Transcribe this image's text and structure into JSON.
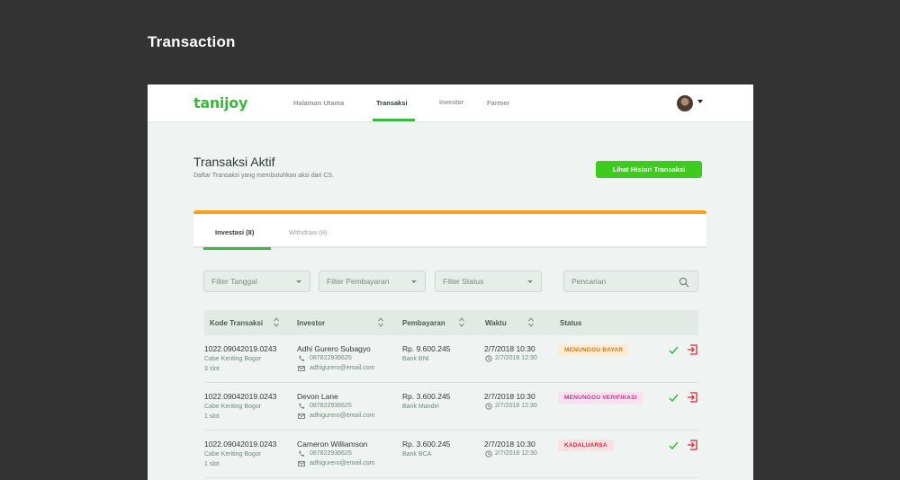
{
  "page_heading": "Transaction",
  "nav": {
    "logo": "tanijoy",
    "items": [
      "Halaman Utama",
      "Transaksi",
      "Investor",
      "Farmer"
    ]
  },
  "main": {
    "title": "Transaksi Aktif",
    "subtitle": "Daftar Transaksi yang membutuhkan aksi dari CS.",
    "history_button": "Lihat Histori Transaksi"
  },
  "tabs": [
    "Investasi (8)",
    "Withdraw (8)"
  ],
  "filters": {
    "tanggal": "Filter Tanggal",
    "pembayaran": "Filter Pembayaran",
    "status": "Filter Status",
    "search_placeholder": "Pencarian"
  },
  "table": {
    "headers": [
      "Kode Transaksi",
      "Investor",
      "Pembayaran",
      "Waktu",
      "Status"
    ],
    "rows": [
      {
        "code": "1022.09042019.0243",
        "product": "Cabe Keriting Bogor",
        "slot": "3 slot",
        "name": "Adhi Gurero Subagyo",
        "phone": "087822936625",
        "email": "adhigurero@email.com",
        "amount": "Rp. 9.600.245",
        "bank": "Bank BNI",
        "date": "2/7/2018 10:30",
        "time": "2/7/2018 12:30",
        "status": "MENUNGGU BAYAR"
      },
      {
        "code": "1022.09042019.0243",
        "product": "Cabe Keriting Bogor",
        "slot": "1 slot",
        "name": "Devon Lane",
        "phone": "087822936625",
        "email": "adhigurero@email.com",
        "amount": "Rp. 3.600.245",
        "bank": "Bank Mandiri",
        "date": "2/7/2018 10:30",
        "time": "2/7/2018 12:30",
        "status": "MENUNGGU VERIFIKASI"
      },
      {
        "code": "1022.09042019.0243",
        "product": "Cabe Keriting Bogor",
        "slot": "1 slot",
        "name": "Cameron Williamson",
        "phone": "087822936625",
        "email": "adhigurero@email.com",
        "amount": "Rp. 3.600.245",
        "bank": "Bank BCA",
        "date": "2/7/2018 10:30",
        "time": "2/7/2018 12:30",
        "status": "KADALUARSA"
      }
    ]
  },
  "colors": {
    "accent": "#3db83f",
    "button": "#3ccb1e",
    "card_top": "#f7a11a",
    "badge_wait_bg": "#fdebd3",
    "badge_wait_fg": "#d07a12",
    "badge_verify_bg": "#fbe0f0",
    "badge_verify_fg": "#c0368a",
    "badge_expired_bg": "#fbe1e1",
    "badge_expired_fg": "#d8263a"
  }
}
